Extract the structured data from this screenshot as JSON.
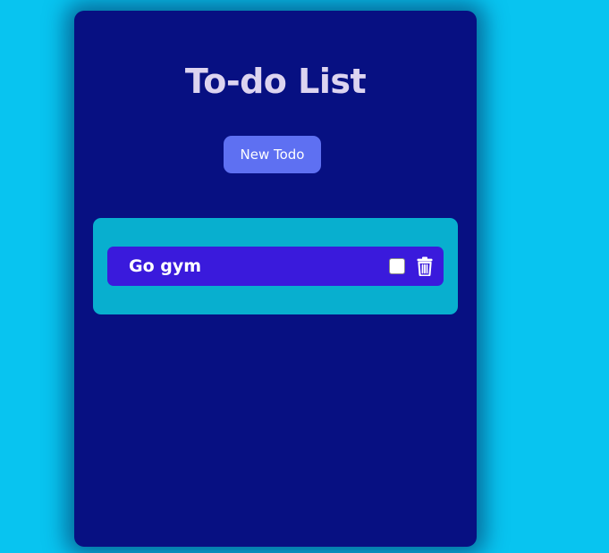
{
  "header": {
    "title": "To-do List"
  },
  "toolbar": {
    "new_todo_label": "New Todo"
  },
  "todos": [
    {
      "text": "Go gym",
      "completed": false
    }
  ],
  "icons": {
    "delete": "trash-icon"
  },
  "colors": {
    "page_background": "#08c4f0",
    "card_background": "#071082",
    "title_text": "#dcd4f0",
    "button_background": "#5e70f2",
    "list_panel": "#08afcf",
    "todo_item": "#3a1adc"
  }
}
